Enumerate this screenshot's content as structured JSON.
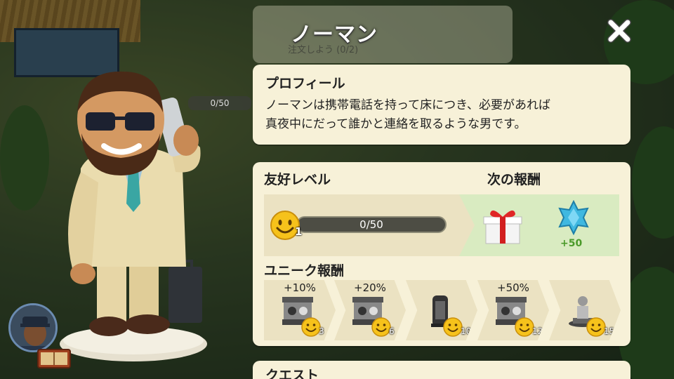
{
  "title": "ノーマン",
  "background": {
    "task_text": "注文しよう (0/2)",
    "progress_text": "0/50"
  },
  "profile": {
    "heading": "プロフィール",
    "line1": "ノーマンは携帯電話を持って床につき、必要があれば",
    "line2": "真夜中にだって誰かと連絡を取るような男です。"
  },
  "friendship": {
    "label": "友好レベル",
    "level": "1",
    "progress_text": "0/50",
    "progress": 0,
    "next_reward_label": "次の報酬",
    "next_rewards": [
      {
        "icon": "gift-icon"
      },
      {
        "icon": "gem-icon",
        "value": "+50"
      }
    ]
  },
  "unique_rewards": {
    "label": "ユニーク報酬",
    "items": [
      {
        "bonus": "+10%",
        "icon": "kiosk-icon",
        "level": "3"
      },
      {
        "bonus": "+20%",
        "icon": "kiosk-icon",
        "level": "6"
      },
      {
        "bonus": "",
        "icon": "phone-booth-icon",
        "level": "10"
      },
      {
        "bonus": "+50%",
        "icon": "kiosk-icon",
        "level": "12"
      },
      {
        "bonus": "",
        "icon": "statue-icon",
        "level": "15"
      }
    ]
  },
  "quest": {
    "heading": "クエスト"
  },
  "colors": {
    "panel": "#f7f1d8",
    "reward_bg": "#d9ebc1",
    "gem": "#3fb8e0",
    "gem_value": "#4b9a2a"
  }
}
